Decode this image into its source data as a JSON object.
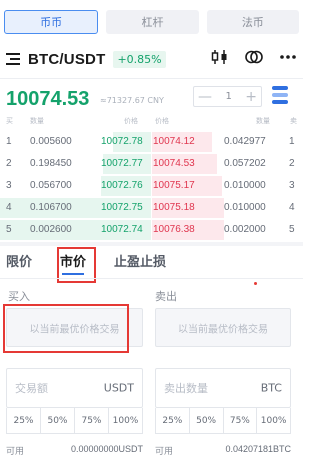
{
  "modes": [
    {
      "label": "币币",
      "active": true
    },
    {
      "label": "杠杆",
      "active": false
    },
    {
      "label": "法币",
      "active": false
    }
  ],
  "pair": {
    "title": "BTC/USDT",
    "change": "+0.85%",
    "icons": [
      "menu-icon",
      "candlestick-icon",
      "coin-switch-icon",
      "more-icon"
    ]
  },
  "price": {
    "last": "10074.53",
    "cny": "≈71327.67 CNY",
    "stepper_value": "1",
    "minus": "—",
    "plus": "+"
  },
  "orderbook": {
    "headers": {
      "buy": "买",
      "amount": "数量",
      "price_left": "价格",
      "price_right": "价格",
      "amount_right": "数量",
      "sell": "卖"
    },
    "rows": [
      {
        "idx": "1",
        "bid_qty": "0.005600",
        "bid_price": "10072.78",
        "ask_price": "10074.12",
        "ask_qty": "0.042977",
        "ask_idx": "1"
      },
      {
        "idx": "2",
        "bid_qty": "0.198450",
        "bid_price": "10072.77",
        "ask_price": "10074.53",
        "ask_qty": "0.057202",
        "ask_idx": "2"
      },
      {
        "idx": "3",
        "bid_qty": "0.056700",
        "bid_price": "10072.76",
        "ask_price": "10075.17",
        "ask_qty": "0.010000",
        "ask_idx": "3"
      },
      {
        "idx": "4",
        "bid_qty": "0.106700",
        "bid_price": "10072.75",
        "ask_price": "10075.18",
        "ask_qty": "0.010000",
        "ask_idx": "4"
      },
      {
        "idx": "5",
        "bid_qty": "0.002600",
        "bid_price": "10072.74",
        "ask_price": "10076.38",
        "ask_qty": "0.002000",
        "ask_idx": "5"
      }
    ]
  },
  "order_tabs": [
    {
      "label": "限价",
      "active": false
    },
    {
      "label": "市价",
      "active": true
    },
    {
      "label": "止盈止损",
      "active": false
    }
  ],
  "buy": {
    "title": "买入",
    "price_placeholder": "以当前最优价格交易",
    "amount_label": "交易额",
    "unit": "USDT",
    "pcts": [
      "25%",
      "50%",
      "75%",
      "100%"
    ],
    "avail_label": "可用",
    "avail_value": "0.00000000USDT"
  },
  "sell": {
    "title": "卖出",
    "price_placeholder": "以当前最优价格交易",
    "amount_label": "卖出数量",
    "unit": "BTC",
    "pcts": [
      "25%",
      "50%",
      "75%",
      "100%"
    ],
    "avail_label": "可用",
    "avail_value": "0.04207181BTC"
  },
  "colors": {
    "accent": "#2f6fe0",
    "up": "#14a26b",
    "down": "#e0364f",
    "highlight": "#e53935"
  }
}
